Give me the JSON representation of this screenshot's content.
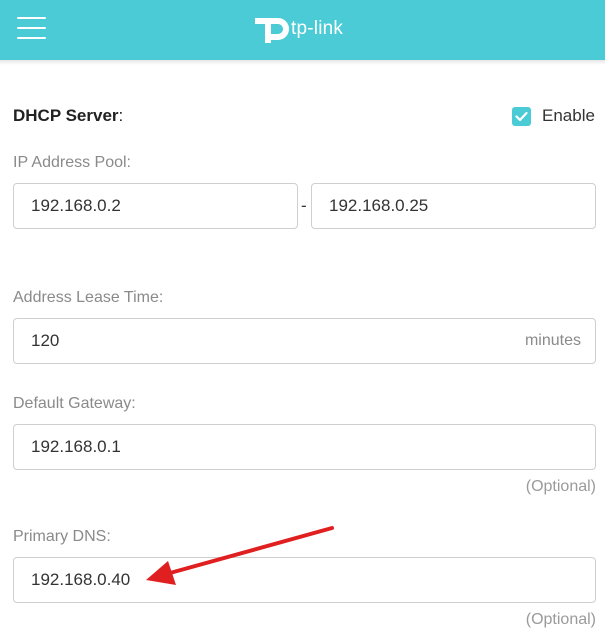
{
  "header": {
    "brand": "tp-link",
    "menu_icon": "hamburger-menu-icon",
    "background": "#4acbd6"
  },
  "dhcp": {
    "title": "DHCP Server",
    "title_suffix": ":",
    "enable_label": "Enable",
    "enabled": true
  },
  "ip_pool": {
    "label": "IP Address Pool:",
    "start": "192.168.0.2",
    "separator": "-",
    "end": "192.168.0.25"
  },
  "lease": {
    "label": "Address Lease Time:",
    "value": "120",
    "unit": "minutes"
  },
  "gateway": {
    "label": "Default Gateway:",
    "value": "192.168.0.1",
    "hint": "(Optional)"
  },
  "primary_dns": {
    "label": "Primary DNS:",
    "value": "192.168.0.40",
    "hint": "(Optional)"
  },
  "annotation": {
    "arrow_color": "#e02020",
    "icon": "red-arrow-icon"
  }
}
